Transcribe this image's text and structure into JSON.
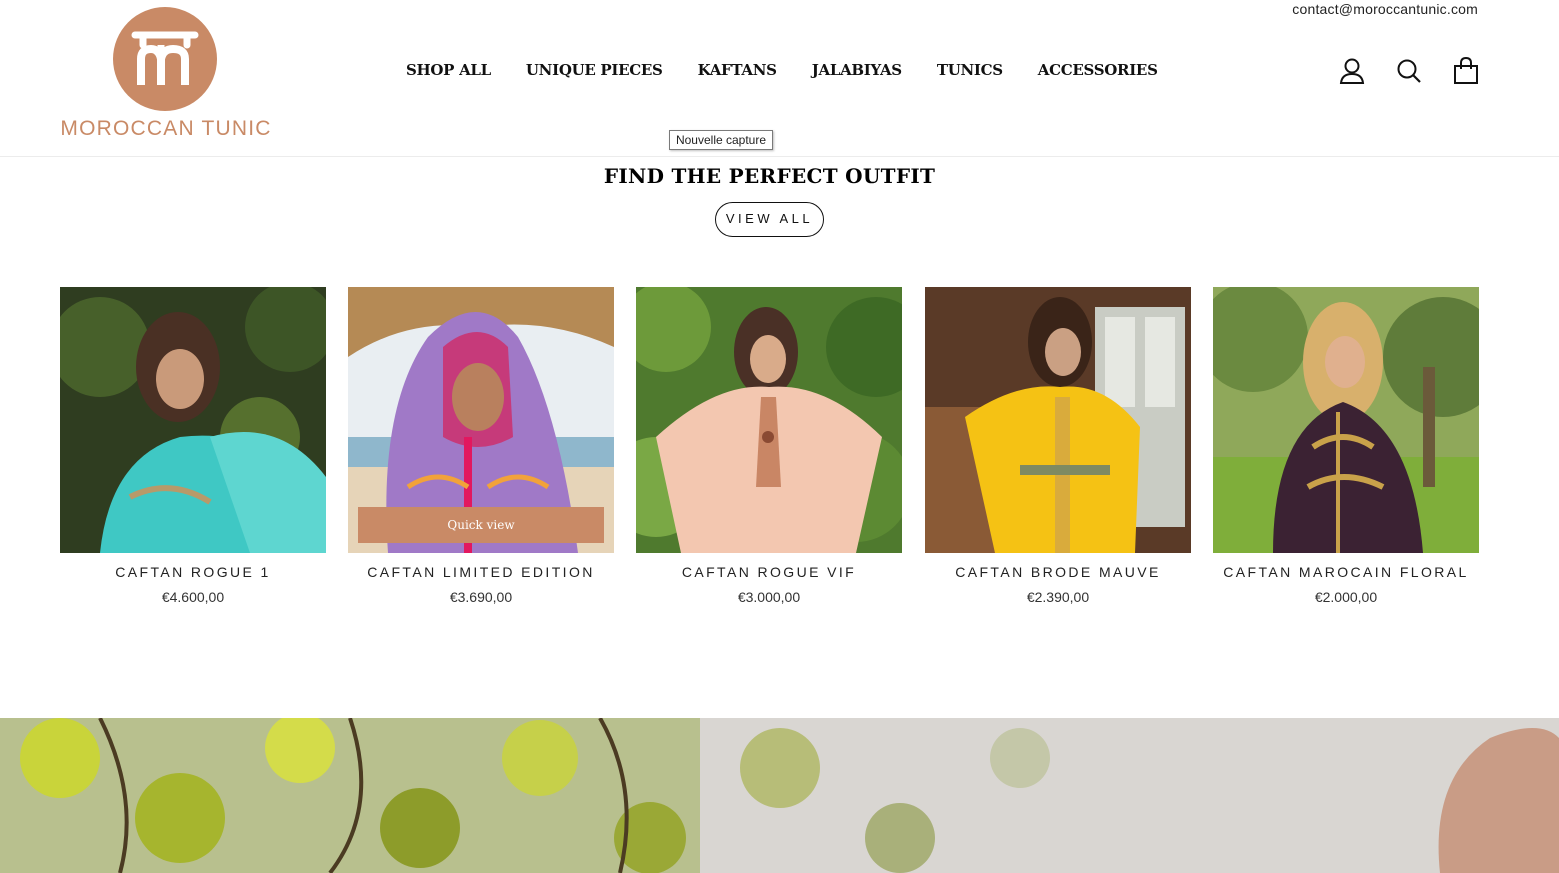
{
  "header": {
    "contact_email": "contact@moroccantunic.com",
    "brand": "MOROCCAN TUNIC",
    "logo_icon": "mt-monogram-logo",
    "brand_color": "#c98a66",
    "nav": [
      "SHOP ALL",
      "UNIQUE PIECES",
      "KAFTANS",
      "JALABIYAS",
      "TUNICS",
      "ACCESSORIES"
    ],
    "icons": [
      "user-icon",
      "search-icon",
      "cart-icon"
    ]
  },
  "tooltip": "Nouvelle capture",
  "section": {
    "title": "FIND THE PERFECT OUTFIT",
    "view_all": "VIEW ALL"
  },
  "products": [
    {
      "name": "CAFTAN ROGUE 1",
      "price": "€4.600,00",
      "color": "turquoise"
    },
    {
      "name": "CAFTAN LIMITED EDITION",
      "price": "€3.690,00",
      "color": "purple-pink",
      "quick_view": "Quick view"
    },
    {
      "name": "CAFTAN ROGUE VIF",
      "price": "€3.000,00",
      "color": "peach"
    },
    {
      "name": "CAFTAN BRODE MAUVE",
      "price": "€2.390,00",
      "color": "yellow"
    },
    {
      "name": "CAFTAN MAROCAIN FLORAL",
      "price": "€2.000,00",
      "color": "dark-plum-gold"
    }
  ]
}
